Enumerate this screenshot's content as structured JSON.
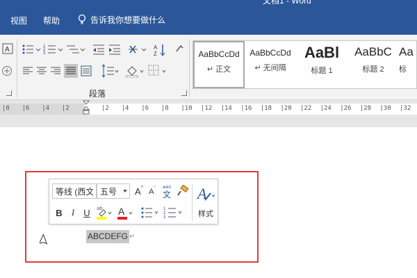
{
  "window": {
    "title": "文档1 - Word"
  },
  "menubar": {
    "items": [
      "视图",
      "帮助"
    ],
    "tell_me": "告诉我你想要做什么"
  },
  "ribbon": {
    "paragraph_group_label": "段落",
    "styles": [
      {
        "sample": "AaBbCcDd",
        "name": "↵ 正文",
        "selected": true
      },
      {
        "sample": "AaBbCcDd",
        "name": "↵ 无间隔",
        "selected": false
      },
      {
        "sample": "AaBl",
        "name": "标题 1",
        "selected": false
      },
      {
        "sample": "AaBbC",
        "name": "标题 2",
        "selected": false
      },
      {
        "sample": "Aa",
        "name": "标",
        "selected": false
      }
    ]
  },
  "ruler": {
    "ticks": [
      "8",
      "6",
      "4",
      "2",
      "",
      "2",
      "4",
      "6",
      "8",
      "10",
      "12",
      "14",
      "16",
      "18",
      "20",
      "22",
      "24",
      "26",
      "28",
      "30",
      "32"
    ]
  },
  "mini_toolbar": {
    "font_name": "等线 (西文",
    "font_size": "五号",
    "grow_font": "A",
    "shrink_font": "A",
    "phonetic": "文",
    "bold": "B",
    "italic": "I",
    "underline": "U",
    "styles_label": "样式"
  },
  "document": {
    "selected_text": "ABCDEFG",
    "paragraph_mark": "↵"
  },
  "colors": {
    "brand": "#2b579a",
    "highlight_box": "#e03a3a",
    "highlighter_yellow": "#ffff00",
    "font_red": "#e02020"
  }
}
